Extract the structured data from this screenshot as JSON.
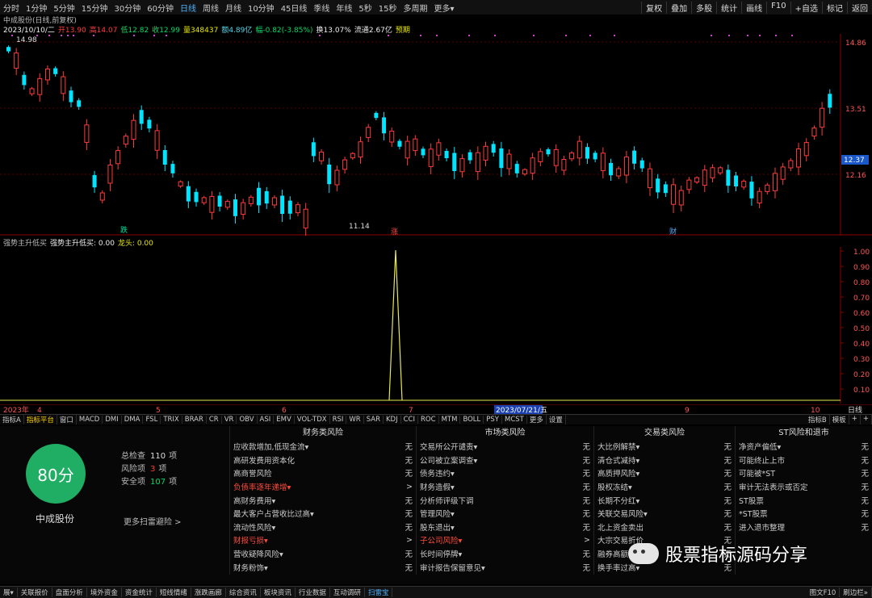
{
  "toolbar": {
    "periods": [
      "分时",
      "1分钟",
      "5分钟",
      "15分钟",
      "30分钟",
      "60分钟",
      "日线",
      "周线",
      "月线",
      "10分钟",
      "45日线",
      "季线",
      "年线",
      "5秒",
      "15秒",
      "多周期",
      "更多▾"
    ],
    "active": "日线",
    "right": [
      "复权",
      "叠加",
      "多股",
      "统计",
      "画线",
      "F10",
      "+自选",
      "标记",
      "返回"
    ]
  },
  "title": "中成股份(日线,前复权)",
  "quote": {
    "date": "2023/10/10/二",
    "open": "开13.90",
    "high": "高14.07",
    "low": "低12.82",
    "close": "收12.99",
    "vol": "量348437",
    "amount": "额4.89亿",
    "change": "幅-0.82(-3.85%)",
    "turnover": "换13.07%",
    "float": "流通2.67亿",
    "extra": "预期"
  },
  "main_chart": {
    "price_labels": [
      "14.86",
      "13.51",
      "12.37",
      "12.16"
    ],
    "current_price": "12.37",
    "max_label": "14.98",
    "min_label": "11.14",
    "markers": [
      "跌",
      "涨",
      "财"
    ],
    "colors": {
      "up": "#ff3b3b",
      "down": "#00e5ff",
      "bg": "#000000",
      "grid": "#8b0000"
    }
  },
  "indicator": {
    "name": "强势主升低买",
    "label1": "强势主升低买: 0.00",
    "label2": "龙头: 0.00",
    "ticks": [
      "1.00",
      "0.90",
      "0.80",
      "0.70",
      "0.60",
      "0.50",
      "0.40",
      "0.30",
      "0.20",
      "0.10"
    ],
    "line_color": "#e8e850"
  },
  "time_axis": {
    "labels": [
      "2023年",
      "4",
      "5",
      "6",
      "7",
      "2023/07/21/五",
      "9",
      "10"
    ],
    "corner": "日线"
  },
  "tabs": {
    "items": [
      "指标A",
      "指标平台",
      "窗口",
      "MACD",
      "DMI",
      "DMA",
      "FSL",
      "TRIX",
      "BRAR",
      "CR",
      "VR",
      "OBV",
      "ASI",
      "EMV",
      "VOL-TDX",
      "RSI",
      "WR",
      "SAR",
      "KDJ",
      "CCI",
      "ROC",
      "MTM",
      "BOLL",
      "PSY",
      "MCST",
      "更多",
      "设置"
    ],
    "active": "指标平台",
    "right": [
      "指标B",
      "模板",
      "+",
      "+"
    ]
  },
  "risk": {
    "score": "80分",
    "stock": "中成股份",
    "summary": [
      {
        "label": "总检查",
        "value": "110",
        "unit": "项",
        "color": "#dddddd"
      },
      {
        "label": "风险项",
        "value": "3",
        "unit": "项",
        "color": "#ff3b3b"
      },
      {
        "label": "安全项",
        "value": "107",
        "unit": "项",
        "color": "#00d96a"
      }
    ],
    "more": "更多扫雷避险 >",
    "columns": [
      {
        "title": "财务类风险",
        "items": [
          [
            "应收款增加,低现金流▾",
            "无",
            false
          ],
          [
            "高研发费用资本化",
            "无",
            false
          ],
          [
            "高商誉风险",
            "无",
            false
          ],
          [
            "负债率逐年递增▾",
            ">",
            true
          ],
          [
            "高财务费用▾",
            "无",
            false
          ],
          [
            "最大客户占营收比过高▾",
            "无",
            false
          ],
          [
            "流动性风险▾",
            "无",
            false
          ],
          [
            "财报亏损▾",
            ">",
            true
          ],
          [
            "营收疑降风险▾",
            "无",
            false
          ],
          [
            "财务粉饰▾",
            "无",
            false
          ]
        ]
      },
      {
        "title": "市场类风险",
        "items": [
          [
            "交易所公开谴责▾",
            "无",
            false
          ],
          [
            "公司被立案调查▾",
            "无",
            false
          ],
          [
            "债务违约▾",
            "无",
            false
          ],
          [
            "财务造假▾",
            "无",
            false
          ],
          [
            "分析师评级下调",
            "无",
            false
          ],
          [
            "管理风险▾",
            "无",
            false
          ],
          [
            "股东退出▾",
            "无",
            false
          ],
          [
            "子公司风险▾",
            ">",
            true
          ],
          [
            "长时间停牌▾",
            "无",
            false
          ],
          [
            "审计报告保留意见▾",
            "无",
            false
          ]
        ]
      },
      {
        "title": "交易类风险",
        "items": [
          [
            "大比例解禁▾",
            "无",
            false
          ],
          [
            "清仓式减持▾",
            "无",
            false
          ],
          [
            "高质押风险▾",
            "无",
            false
          ],
          [
            "股权冻结▾",
            "无",
            false
          ],
          [
            "长期不分红▾",
            "无",
            false
          ],
          [
            "关联交易风险▾",
            "无",
            false
          ],
          [
            "北上资金卖出",
            "无",
            false
          ],
          [
            "大宗交易折价",
            "无",
            false
          ],
          [
            "融券高额",
            "无",
            false
          ],
          [
            "换手率过高▾",
            "无",
            false
          ]
        ]
      },
      {
        "title": "ST风险和退市",
        "items": [
          [
            "净资产偏低▾",
            "无",
            false
          ],
          [
            "可能终止上市",
            "无",
            false
          ],
          [
            "可能被*ST",
            "无",
            false
          ],
          [
            "审计无法表示或否定",
            "无",
            false
          ],
          [
            "ST股票",
            "无",
            false
          ],
          [
            "*ST股票",
            "无",
            false
          ],
          [
            "进入退市整理",
            "无",
            false
          ]
        ]
      }
    ]
  },
  "bottom": {
    "items": [
      "展▾",
      "关联报价",
      "盘面分析",
      "境外资金",
      "资金统计",
      "短线情绪",
      "涨跌画廊",
      "综合资讯",
      "板块资讯",
      "行业数据",
      "互动调研",
      "扫雷宝"
    ],
    "active": "扫雷宝",
    "right": [
      "图文F10",
      "刷边栏»"
    ]
  },
  "watermark": "股票指标源码分享"
}
